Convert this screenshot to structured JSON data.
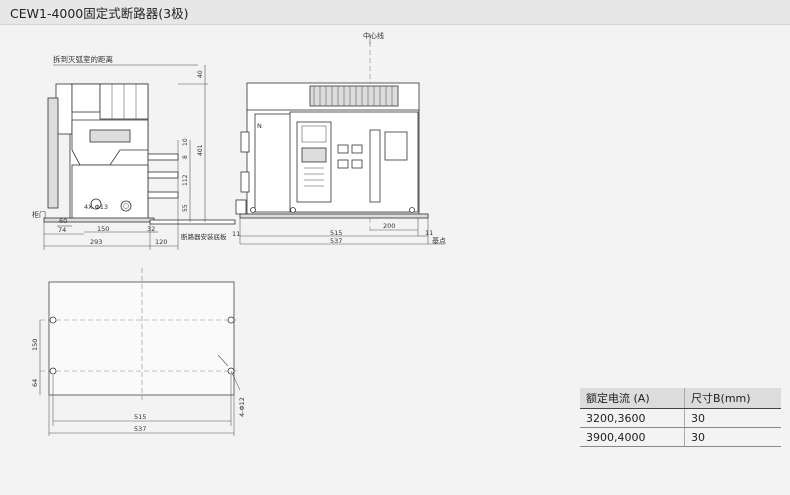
{
  "title": "CEW1-4000固定式断路器(3极)",
  "labels": {
    "arc_distance": "拆到灭弧室的距离",
    "center_line": "中心线",
    "cabinet_door": "柜门",
    "mount_plate": "断路器安装底板",
    "datum": "基点",
    "hole_note": "4X Φ13",
    "bolt_note": "4-Φ12",
    "pole_n": "N"
  },
  "dims": {
    "d40": "40",
    "d401": "401",
    "d10": "10",
    "d8": "8",
    "d112": "112",
    "d55": "55",
    "d60": "60",
    "d74": "74",
    "d150": "150",
    "d32": "32",
    "d293": "293",
    "d120": "120",
    "d11a": "11",
    "d200": "200",
    "d515": "515",
    "d11b": "11",
    "d537": "537",
    "p150": "150",
    "p64": "64",
    "p515": "515",
    "p537": "537"
  },
  "table": {
    "headers": [
      "额定电流 (A)",
      "尺寸B(mm)"
    ],
    "rows": [
      [
        "3200,3600",
        "30"
      ],
      [
        "3900,4000",
        "30"
      ]
    ]
  }
}
